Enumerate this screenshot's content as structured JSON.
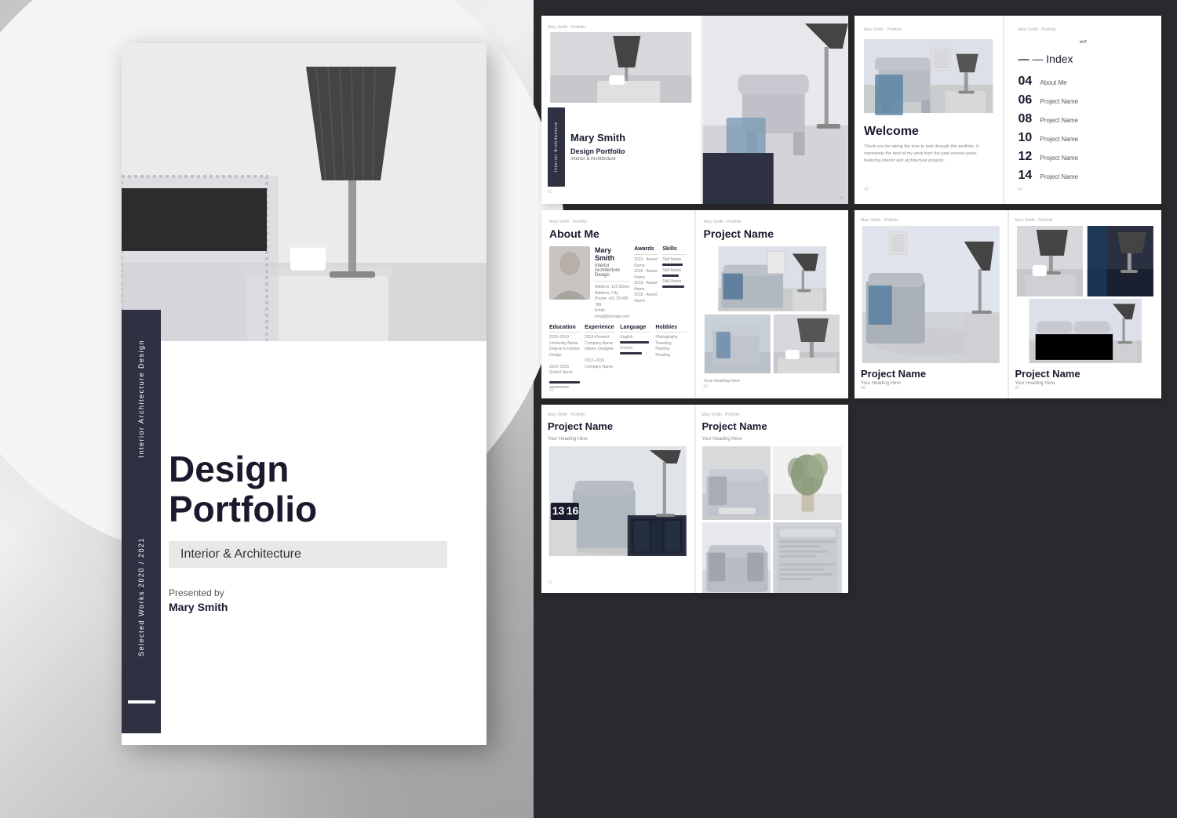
{
  "background": {
    "left_color": "#c8c8c8",
    "right_color": "#2a2a2e"
  },
  "cover": {
    "vertical_text_1": "Interior Architecture Design",
    "vertical_text_2": "Selected Works 2020 / 2021",
    "title": "Design Portfolio",
    "subtitle": "Interior & Architecture",
    "presented_by": "Presented by",
    "author": "Mary Smith",
    "photo_alt": "Bedroom with lamp"
  },
  "spreads": {
    "spread1": {
      "left": {
        "label": "Mary Smith",
        "title": "Design Portfolio",
        "subtitle": "Interior & Architecture"
      },
      "right": {
        "description": "Cover preview"
      }
    },
    "spread2": {
      "left": {
        "welcome_title": "Welcome",
        "welcome_text": "Thank you for taking the time to look through this portfolio. It represents the best of my work from the past several years, featuring interior and architecture projects."
      },
      "right": {
        "title": "— Index",
        "items": [
          {
            "num": "04",
            "label": "About Me"
          },
          {
            "num": "06",
            "label": "Project Name"
          },
          {
            "num": "08",
            "label": "Project Name"
          },
          {
            "num": "10",
            "label": "Project Name"
          },
          {
            "num": "12",
            "label": "Project Name"
          },
          {
            "num": "14",
            "label": "Project Name"
          }
        ]
      }
    },
    "spread3": {
      "left": {
        "title": "About Me",
        "name": "Mary Smith",
        "role": "Interior Architecture Design",
        "sections": [
          "Awards",
          "Skills",
          "Education",
          "Experience",
          "Language",
          "Hobbies"
        ]
      },
      "right": {
        "title": "Project Name",
        "heading_note": "Your Heading Here"
      }
    },
    "spread4": {
      "left": {
        "title": "Project Name",
        "heading_note": "Your Heading Here"
      },
      "right": {
        "title": "Project Name",
        "heading_note": "Your Heading Here"
      }
    },
    "spread5": {
      "left": {
        "title": "Project Name",
        "heading_note": "Your Heading Here"
      },
      "right": {
        "title": "Project Name",
        "heading_note": "Your Heading Here"
      }
    }
  }
}
